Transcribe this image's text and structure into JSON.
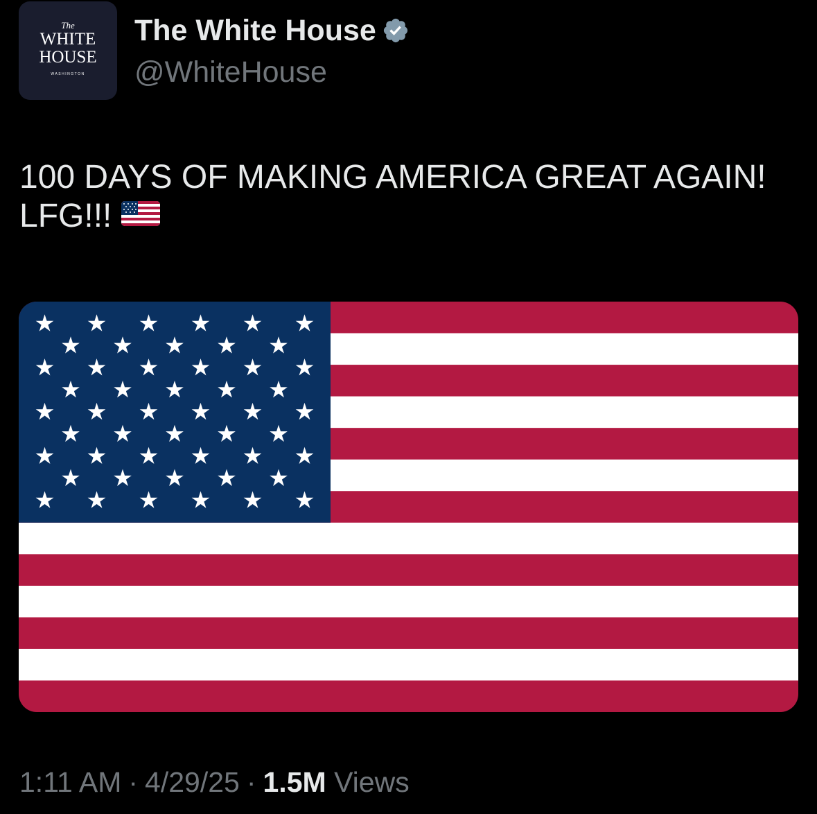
{
  "author": {
    "display_name": "The White House",
    "handle": "@WhiteHouse",
    "verified": true,
    "verified_icon": "verified-badge-icon",
    "avatar": {
      "line1": "The",
      "line2": "WHITE",
      "line3": "HOUSE",
      "line4": "WASHINGTON"
    }
  },
  "tweet": {
    "text": "100 DAYS OF MAKING AMERICA GREAT AGAIN! LFG!!!",
    "emoji": "us-flag-icon"
  },
  "media": {
    "description_icon": "american-flag-image"
  },
  "meta": {
    "time": "1:11 AM",
    "separator": "·",
    "date": "4/29/25",
    "views_count": "1.5M",
    "views_label": "Views"
  },
  "colors": {
    "background": "#000000",
    "text_primary": "#e7e9ea",
    "text_secondary": "#71767b",
    "verified_badge": "#829aab",
    "flag_red": "#b31942",
    "flag_white": "#ffffff",
    "flag_blue": "#0a3161"
  }
}
